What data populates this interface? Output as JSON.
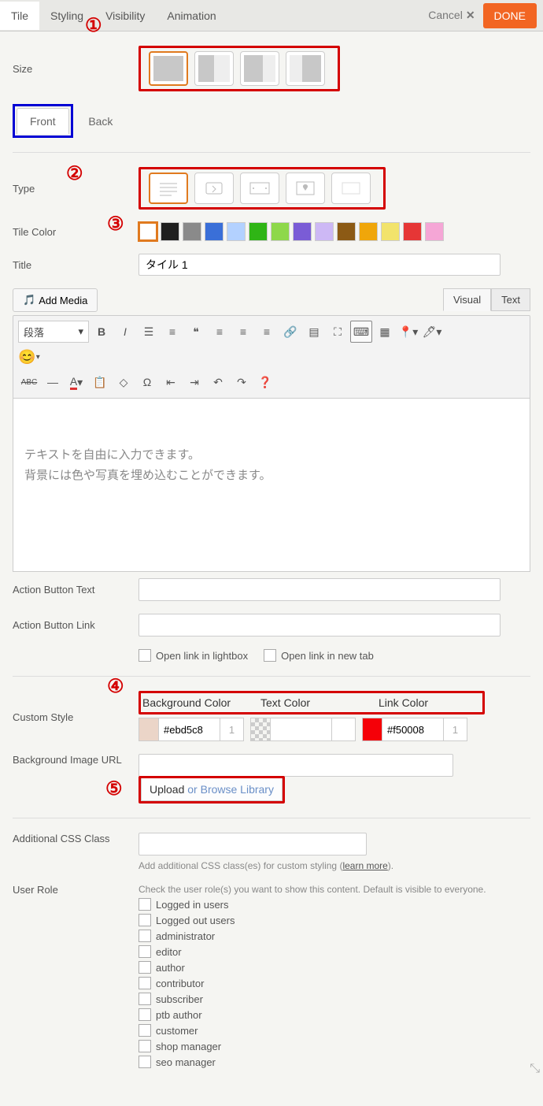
{
  "topTabs": [
    "Tile",
    "Styling",
    "Visibility",
    "Animation"
  ],
  "cancel": "Cancel",
  "done": "DONE",
  "labels": {
    "size": "Size",
    "type": "Type",
    "tileColor": "Tile Color",
    "title": "Title",
    "addMedia": "Add Media",
    "actionBtnText": "Action Button Text",
    "actionBtnLink": "Action Button Link",
    "openLightbox": "Open link in lightbox",
    "openNewTab": "Open link in new tab",
    "customStyle": "Custom Style",
    "bgColor": "Background Color",
    "textColor": "Text Color",
    "linkColor": "Link Color",
    "bgImage": "Background Image URL",
    "upload": "Upload",
    "orBrowse": " or Browse Library",
    "addlCss": "Additional CSS Class",
    "cssHelp": "Add additional CSS class(es) for custom styling (",
    "learnMore": "learn more",
    "cssHelpEnd": ").",
    "userRole": "User Role",
    "roleHelp": "Check the user role(s) you want to show this content. Default is visible to everyone."
  },
  "frontBack": {
    "front": "Front",
    "back": "Back"
  },
  "editor": {
    "visual": "Visual",
    "text": "Text",
    "paragraph": "段落",
    "sampleLine1": "テキストを自由に入力できます。",
    "sampleLine2": "背景には色や写真を埋め込むことができます。"
  },
  "titleValue": "タイル 1",
  "swatchColors": [
    "#ffffff",
    "#1f1f1f",
    "#8a8a8a",
    "#3a6fd8",
    "#b3d1ff",
    "#2fb515",
    "#8ed84a",
    "#7a5cd6",
    "#cdb8f5",
    "#8c5a15",
    "#f0a60a",
    "#f2e36b",
    "#e63636",
    "#f5a6d6"
  ],
  "customStyle": {
    "bgVal": "#ebd5c8",
    "bgOpacity": "1",
    "textVal": "",
    "textOpacity": "",
    "linkVal": "#f50008",
    "linkOpacity": "1"
  },
  "roles": [
    "Logged in users",
    "Logged out users",
    "administrator",
    "editor",
    "author",
    "contributor",
    "subscriber",
    "ptb author",
    "customer",
    "shop manager",
    "seo manager"
  ],
  "annots": [
    "①",
    "②",
    "③",
    "④",
    "⑤"
  ]
}
